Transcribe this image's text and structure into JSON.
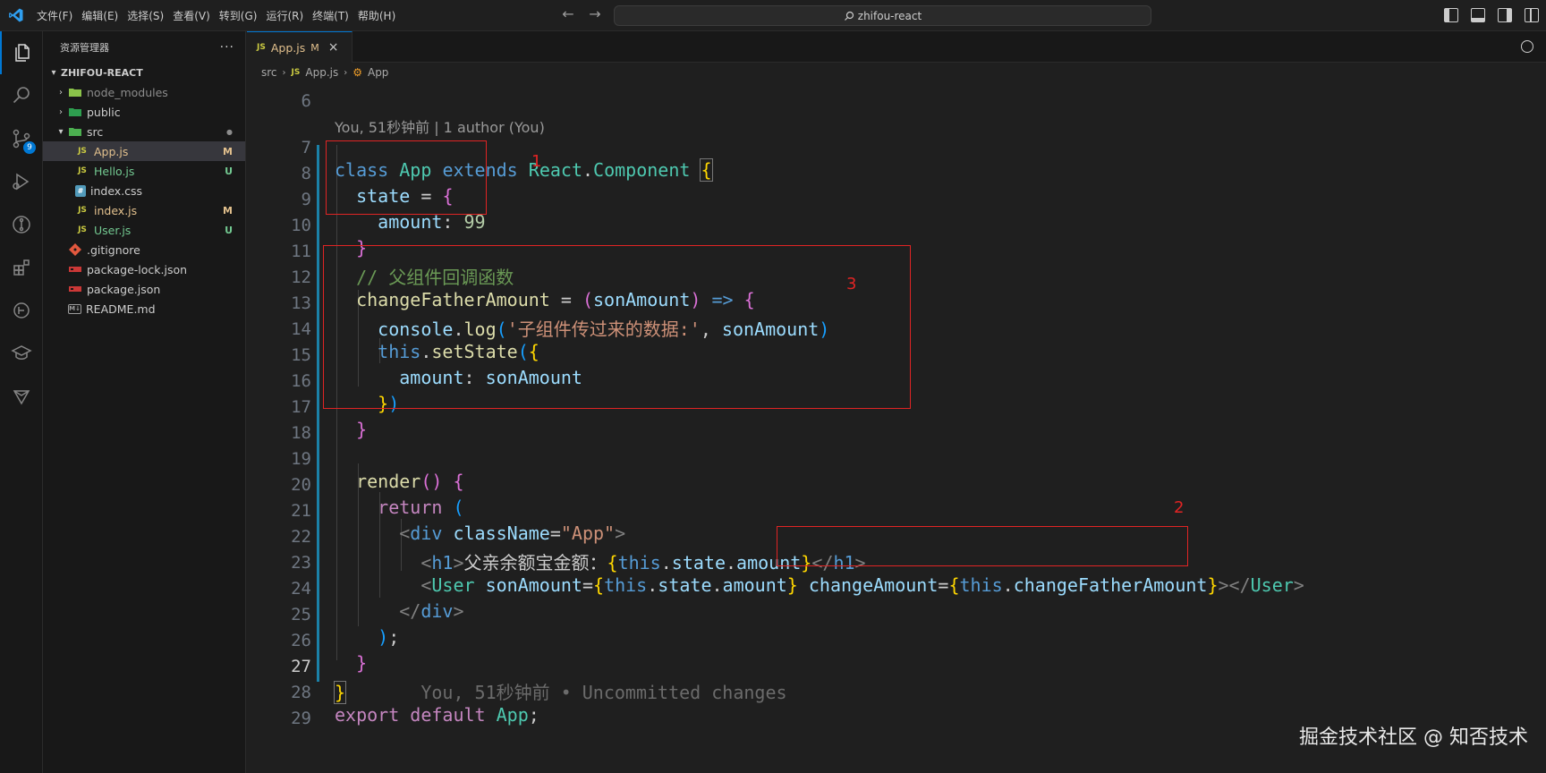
{
  "menubar": {
    "items": [
      "文件(F)",
      "编辑(E)",
      "选择(S)",
      "查看(V)",
      "转到(G)",
      "运行(R)",
      "终端(T)",
      "帮助(H)"
    ]
  },
  "command_center": {
    "label": "zhifou-react"
  },
  "activity_badge": "9",
  "sidebar": {
    "title": "资源管理器",
    "more": "···",
    "root": "ZHIFOU-REACT",
    "rows": [
      {
        "name": "node_modules",
        "status": ""
      },
      {
        "name": "public",
        "status": ""
      },
      {
        "name": "src",
        "status": ""
      },
      {
        "name": "App.js",
        "status": "M"
      },
      {
        "name": "Hello.js",
        "status": "U"
      },
      {
        "name": "index.css",
        "status": ""
      },
      {
        "name": "index.js",
        "status": "M"
      },
      {
        "name": "User.js",
        "status": "U"
      },
      {
        "name": ".gitignore",
        "status": ""
      },
      {
        "name": "package-lock.json",
        "status": ""
      },
      {
        "name": "package.json",
        "status": ""
      },
      {
        "name": "README.md",
        "status": ""
      }
    ],
    "icon_labels": {
      "js": "JS",
      "css": "#",
      "md": "M↓"
    }
  },
  "editor": {
    "tab": {
      "file_icon": "JS",
      "name": "App.js",
      "status": "M",
      "close": "×"
    },
    "breadcrumb": {
      "folder": "src",
      "file_icon": "JS",
      "file": "App.js",
      "symbol": "App"
    },
    "codelens": "You, 51秒钟前 | 1 author (You)",
    "blame": "You, 51秒钟前 • Uncommitted changes",
    "line_numbers": [
      "6",
      "7",
      "8",
      "9",
      "10",
      "11",
      "12",
      "13",
      "14",
      "15",
      "16",
      "17",
      "18",
      "19",
      "20",
      "21",
      "22",
      "23",
      "24",
      "25",
      "26",
      "27",
      "28",
      "29"
    ],
    "code": {
      "l7": [
        "class",
        "App",
        "extends",
        "React",
        ".",
        "Component",
        "{"
      ],
      "l8": [
        "state",
        " = ",
        "{"
      ],
      "l9": [
        "amount",
        ": ",
        "99"
      ],
      "l10": [
        "}"
      ],
      "l11": "// 父组件回调函数",
      "l12": [
        "changeFatherAmount",
        " = ",
        "(",
        "sonAmount",
        ") ",
        "=>",
        " ",
        "{"
      ],
      "l13": [
        "console",
        ".",
        "log",
        "(",
        "'子组件传过来的数据:'",
        ", ",
        "sonAmount",
        ")"
      ],
      "l14": [
        "this",
        ".",
        "setState",
        "(",
        "{"
      ],
      "l15": [
        "amount",
        ": ",
        "sonAmount"
      ],
      "l16": [
        "}",
        ")"
      ],
      "l17": [
        "}"
      ],
      "l19": [
        "render",
        "()",
        " ",
        "{"
      ],
      "l20": [
        "return",
        " ",
        "("
      ],
      "l21": [
        "<",
        "div",
        " ",
        "className",
        "=",
        "\"App\"",
        ">"
      ],
      "l22": [
        "<",
        "h1",
        ">",
        "父亲余额宝金额：",
        "{",
        "this",
        ".",
        "state",
        ".",
        "amount",
        "}",
        "</",
        "h1",
        ">"
      ],
      "l23": [
        "<",
        "User",
        " ",
        "sonAmount",
        "=",
        "{",
        "this",
        ".",
        "state",
        ".",
        "amount",
        "}",
        " ",
        "changeAmount",
        "=",
        "{",
        "this",
        ".",
        "changeFatherAmount",
        "}",
        "></",
        "User",
        ">"
      ],
      "l24": [
        "</",
        "div",
        ">"
      ],
      "l25": [
        ")",
        ";"
      ],
      "l26": [
        "}"
      ],
      "l27": [
        "}"
      ],
      "l28": [
        "export",
        "default",
        "App",
        ";"
      ]
    }
  },
  "annotations": [
    "1",
    "3",
    "2"
  ],
  "watermark": "掘金技术社区 @ 知否技术"
}
